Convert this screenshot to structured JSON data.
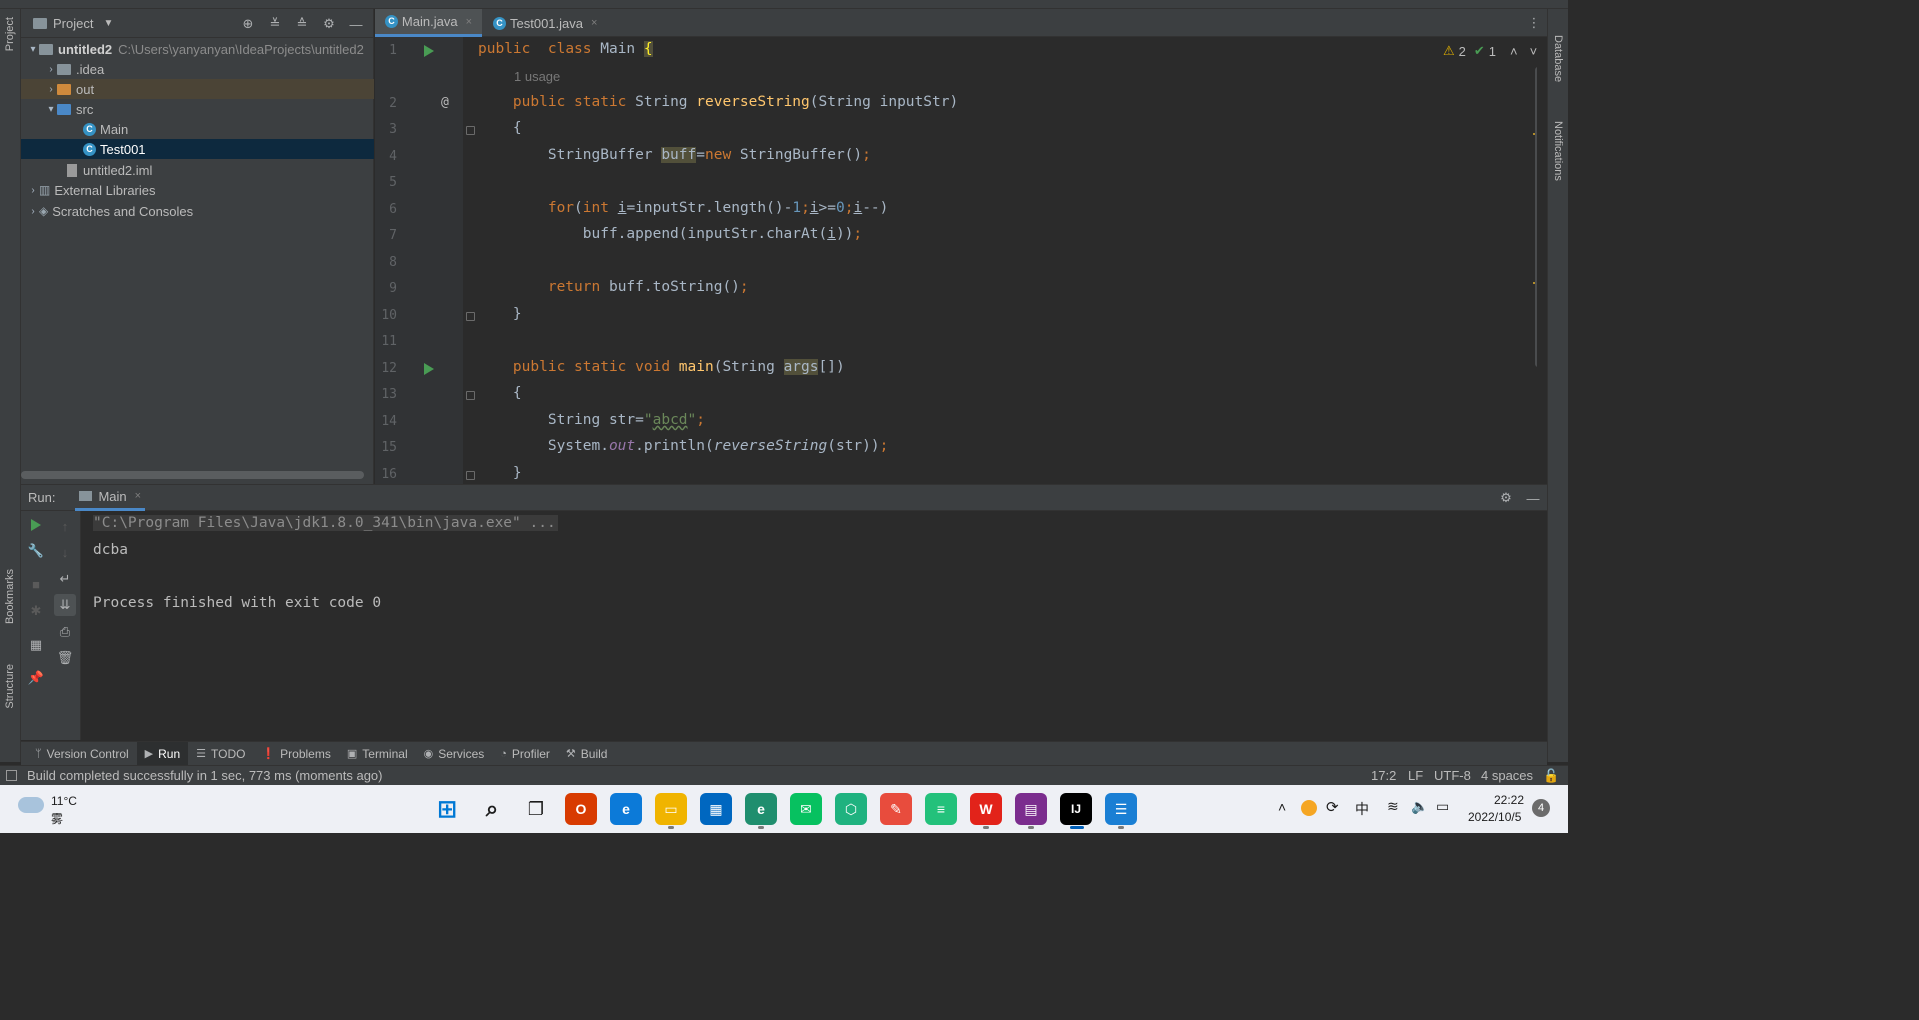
{
  "project_panel": {
    "title": "Project",
    "tree": [
      {
        "label": "untitled2",
        "extra": "C:\\Users\\yanyanyan\\IdeaProjects\\untitled2",
        "level": 0,
        "expanded": true,
        "icon": "module-folder-icon"
      },
      {
        "label": ".idea",
        "level": 1,
        "expanded": false,
        "icon": "folder-icon"
      },
      {
        "label": "out",
        "level": 1,
        "expanded": false,
        "icon": "excluded-folder-icon"
      },
      {
        "label": "src",
        "level": 1,
        "expanded": true,
        "icon": "source-folder-icon"
      },
      {
        "label": "Main",
        "level": 2,
        "icon": "java-class-icon"
      },
      {
        "label": "Test001",
        "level": 2,
        "icon": "java-class-icon",
        "selected": true
      },
      {
        "label": "untitled2.iml",
        "level": 1,
        "icon": "iml-file-icon"
      },
      {
        "label": "External Libraries",
        "level": 0,
        "expanded": false,
        "icon": "libraries-icon"
      },
      {
        "label": "Scratches and Consoles",
        "level": 0,
        "expanded": false,
        "icon": "scratches-icon"
      }
    ]
  },
  "editor_tabs": [
    {
      "label": "Main.java",
      "active": true
    },
    {
      "label": "Test001.java",
      "active": false
    }
  ],
  "inspection": {
    "warnings": "2",
    "ok": "1"
  },
  "code": {
    "usage_hint": "1 usage",
    "line_numbers": [
      "1",
      "2",
      "3",
      "4",
      "5",
      "6",
      "7",
      "8",
      "9",
      "10",
      "11",
      "12",
      "13",
      "14",
      "15",
      "16"
    ]
  },
  "run_panel": {
    "label": "Run:",
    "tab": "Main",
    "output": [
      "\"C:\\Program Files\\Java\\jdk1.8.0_341\\bin\\java.exe\" ...",
      "dcba",
      "",
      "Process finished with exit code 0"
    ]
  },
  "side_labels": {
    "project": "Project",
    "bookmarks": "Bookmarks",
    "structure": "Structure",
    "database": "Database",
    "notifications": "Notifications"
  },
  "bottom_tools": [
    {
      "label": "Version Control",
      "icon": "branch-icon"
    },
    {
      "label": "Run",
      "icon": "play-icon",
      "active": true
    },
    {
      "label": "TODO",
      "icon": "list-icon"
    },
    {
      "label": "Problems",
      "icon": "warning-circle-icon"
    },
    {
      "label": "Terminal",
      "icon": "terminal-icon"
    },
    {
      "label": "Services",
      "icon": "services-icon"
    },
    {
      "label": "Profiler",
      "icon": "profiler-icon"
    },
    {
      "label": "Build",
      "icon": "hammer-icon"
    }
  ],
  "status_bar": {
    "message": "Build completed successfully in 1 sec, 773 ms (moments ago)",
    "position": "17:2",
    "line_sep": "LF",
    "encoding": "UTF-8",
    "indent": "4 spaces"
  },
  "taskbar": {
    "weather_temp": "11°C",
    "weather_desc": "雾",
    "ime": "中",
    "time": "22:22",
    "date": "2022/10/5",
    "notif_count": "4"
  }
}
